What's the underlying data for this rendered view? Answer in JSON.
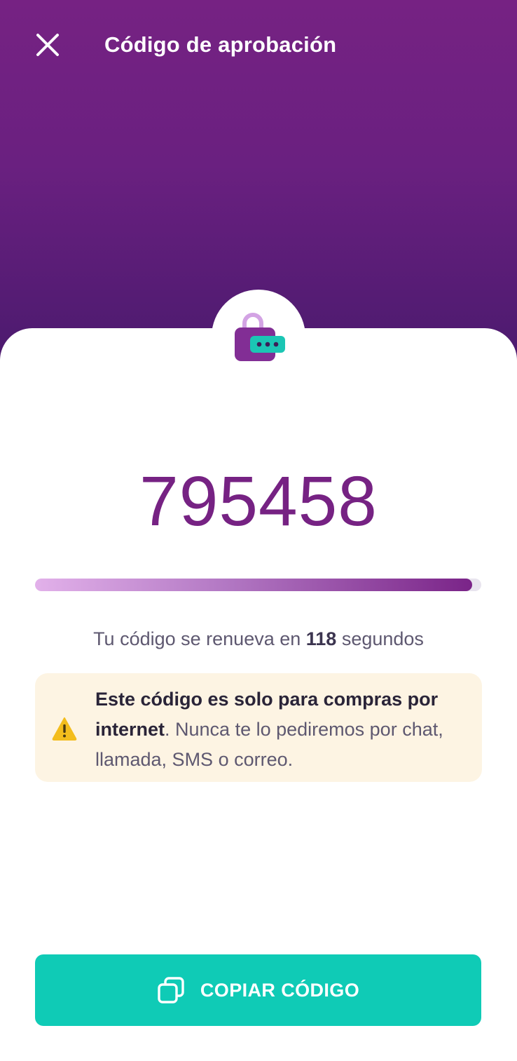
{
  "header": {
    "title": "Código de aprobación",
    "close_icon": "close-icon",
    "gradient_top": "#762283",
    "gradient_bottom": "#4b1a6e"
  },
  "badge": {
    "icon": "lock-dots-icon"
  },
  "code": {
    "value": "795458",
    "color": "#762283"
  },
  "timer": {
    "progress": 0.98,
    "prefix": "Tu código se renueva en ",
    "seconds": "118",
    "suffix": " segundos"
  },
  "notice": {
    "icon": "warning-icon",
    "bold_text": "Este código es solo para compras por internet",
    "normal_text": ". Nunca te lo pediremos por chat, llamada, SMS o correo.",
    "background": "#fdf4e3"
  },
  "copy_button": {
    "label": "COPIAR CÓDIGO",
    "icon": "copy-icon",
    "color": "#0fcbb6"
  }
}
